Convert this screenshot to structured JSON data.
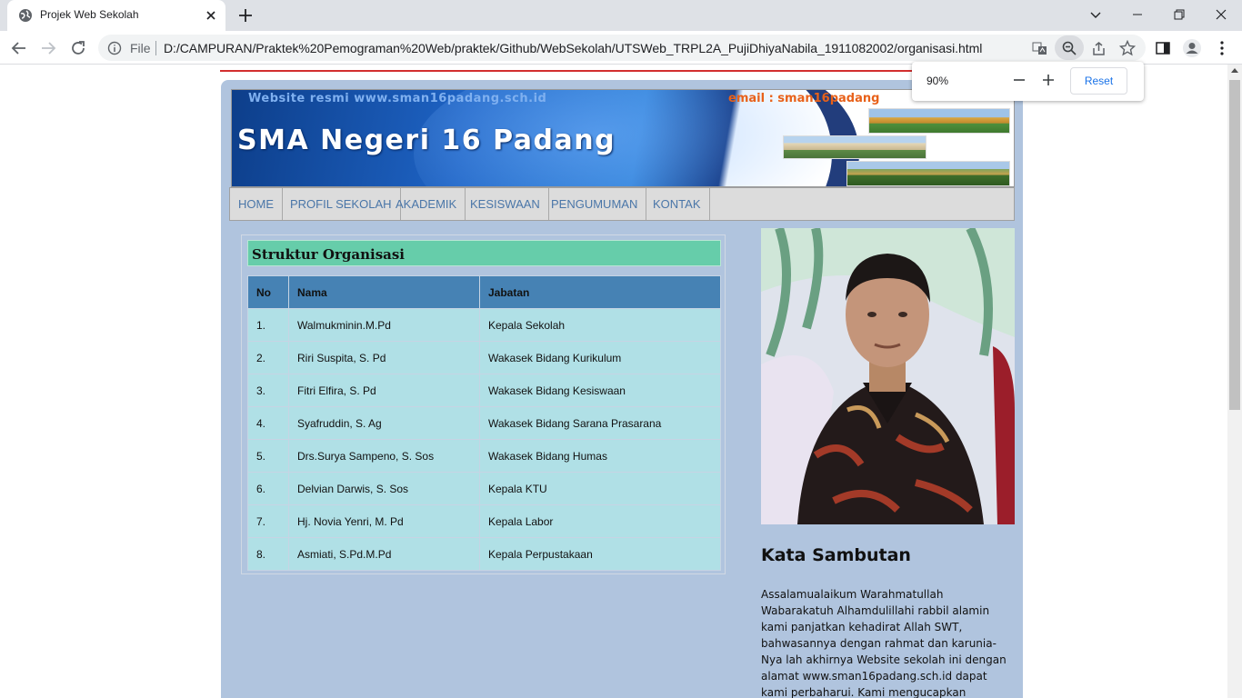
{
  "browser": {
    "tab_title": "Projek Web Sekolah",
    "url_scheme_label": "File",
    "url": "D:/CAMPURAN/Praktek%20Pemograman%20Web/praktek/Github/WebSekolah/UTSWeb_TRPL2A_PujiDhiyaNabila_1911082002/organisasi.html",
    "zoom": {
      "value": "90%",
      "reset_label": "Reset"
    }
  },
  "page": {
    "banner": {
      "website_text": "Website resmi www.sman16padang.sch.id",
      "title": "SMA Negeri 16 Padang",
      "email_text": "email : sman16padang"
    },
    "nav": [
      "HOME",
      "PROFIL SEKOLAH",
      "AKADEMIK",
      "KESISWAAN",
      "PENGUMUMAN",
      "KONTAK"
    ],
    "org": {
      "heading": "Struktur Organisasi",
      "columns": [
        "No",
        "Nama",
        "Jabatan"
      ],
      "rows": [
        [
          "1.",
          "Walmukminin.M.Pd",
          "Kepala Sekolah"
        ],
        [
          "2.",
          "Riri Suspita, S. Pd",
          "Wakasek Bidang Kurikulum"
        ],
        [
          "3.",
          "Fitri Elfira, S. Pd",
          "Wakasek Bidang Kesiswaan"
        ],
        [
          "4.",
          "Syafruddin, S. Ag",
          "Wakasek Bidang Sarana Prasarana"
        ],
        [
          "5.",
          "Drs.Surya Sampeno, S. Sos",
          "Wakasek Bidang Humas"
        ],
        [
          "6.",
          "Delvian Darwis, S. Sos",
          "Kepala KTU"
        ],
        [
          "7.",
          "Hj. Novia Yenri, M. Pd",
          "Kepala Labor"
        ],
        [
          "8.",
          "Asmiati, S.Pd.M.Pd",
          "Kepala Perpustakaan"
        ]
      ]
    },
    "sidebar": {
      "title": "Kata Sambutan",
      "text": "Assalamualaikum Warahmatullah Wabarakatuh Alhamdulillahi rabbil alamin kami panjatkan kehadirat Allah SWT, bahwasannya dengan rahmat dan karunia-Nya lah akhirnya Website sekolah ini dengan alamat www.sman16padang.sch.id dapat kami perbaharui. Kami mengucapkan selamat"
    }
  }
}
